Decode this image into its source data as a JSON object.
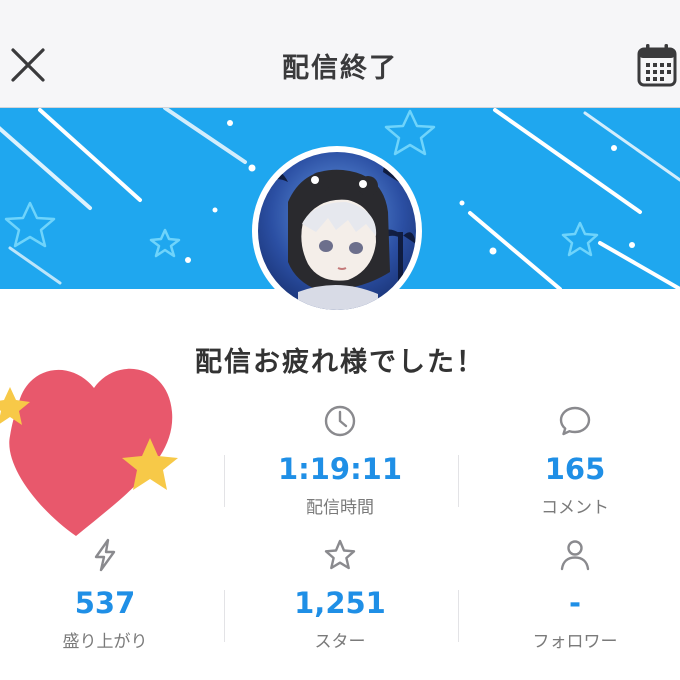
{
  "header": {
    "title": "配信終了",
    "close_icon": "close-icon",
    "calendar_icon": "calendar-icon"
  },
  "banner": {
    "background_color": "#1fa7ef",
    "avatar": "streamer-avatar"
  },
  "heading": "配信お疲れ様でした！",
  "stats": [
    {
      "icon": "heart-icon",
      "value": "",
      "label": ""
    },
    {
      "icon": "clock-icon",
      "value": "1:19:11",
      "label": "配信時間"
    },
    {
      "icon": "comment-icon",
      "value": "165",
      "label": "コメント"
    },
    {
      "icon": "lightning-icon",
      "value": "537",
      "label": "盛り上がり"
    },
    {
      "icon": "star-icon",
      "value": "1,251",
      "label": "スター"
    },
    {
      "icon": "person-icon",
      "value": "-",
      "label": "フォロワー"
    }
  ],
  "colors": {
    "accent": "#1f8fe6",
    "heart": "#e8586c",
    "sparkle": "#f7c948"
  }
}
